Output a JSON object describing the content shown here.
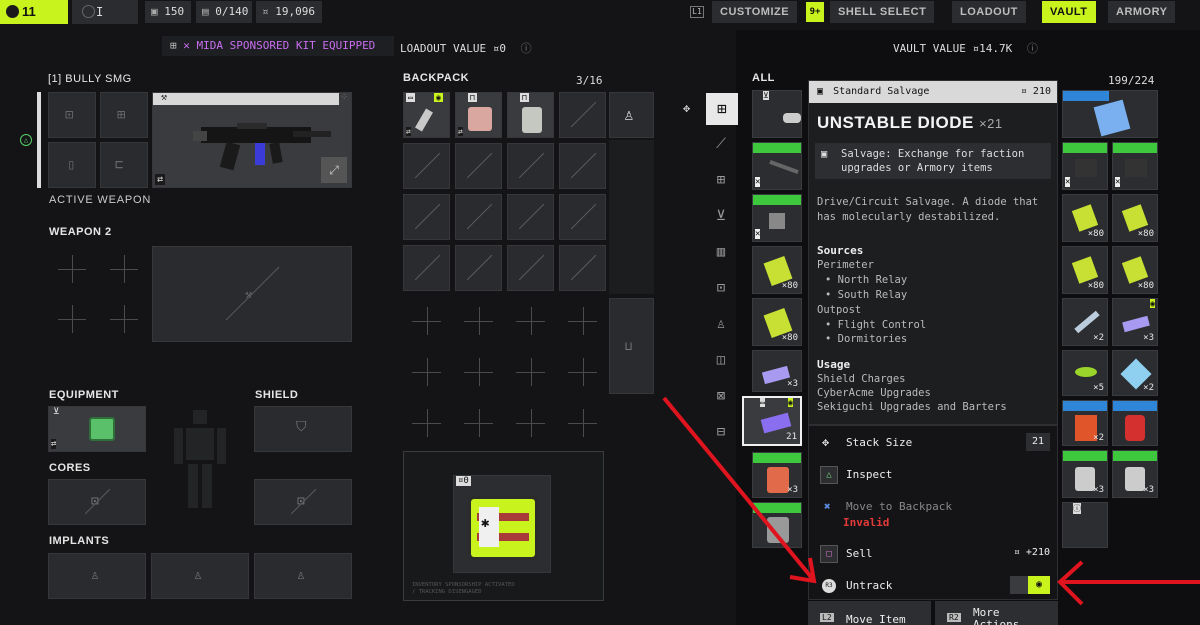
{
  "top_bar": {
    "level": "11",
    "rank_glyph": "I",
    "stat_1": "150",
    "stat_2": "0/140",
    "credits": "19,096",
    "l1_hint": "L1",
    "tabs": {
      "customize": "CUSTOMIZE",
      "badge": "9+",
      "shell_select": "SHELL SELECT",
      "loadout": "LOADOUT",
      "vault": "VAULT",
      "armory": "ARMORY"
    }
  },
  "loadout_header": {
    "sponsored": "MIDA SPONSORED KIT EQUIPPED",
    "value_label": "LOADOUT VALUE",
    "value": "¤0",
    "info_icon": "info-icon"
  },
  "vault_header": {
    "value_label": "VAULT VALUE",
    "value": "¤14.7K"
  },
  "weapon1": {
    "slot_label": "[1] BULLY SMG",
    "caption": "ACTIVE WEAPON"
  },
  "weapon2": {
    "label": "WEAPON 2"
  },
  "equipment": {
    "label": "EQUIPMENT"
  },
  "shield": {
    "label": "SHIELD"
  },
  "cores": {
    "label": "CORES"
  },
  "implants": {
    "label": "IMPLANTS"
  },
  "backpack": {
    "label": "BACKPACK",
    "count": "3/16",
    "kit_value": "¤0",
    "kit_caption_1": "INVENTORY SPONSORSHIP ACTIVATED",
    "kit_caption_2": "/ TRACKING DISENGAGED"
  },
  "vault": {
    "filter": "ALL",
    "count": "199/224"
  },
  "tooltip": {
    "category": "Standard Salvage",
    "price": "¤ 210",
    "name": "UNSTABLE DIODE",
    "qty": "×21",
    "salvage_note": "Salvage: Exchange for faction upgrades or Armory items",
    "description": "Drive/Circuit Salvage. A diode that has molecularly destabilized.",
    "sources_title": "Sources",
    "source_1": "Perimeter",
    "source_1a": "• North Relay",
    "source_1b": "• South Relay",
    "source_2": "Outpost",
    "source_2a": "• Flight Control",
    "source_2b": "• Dormitories",
    "usage_title": "Usage",
    "usage_1": "Shield Charges",
    "usage_2": "CyberAcme Upgrades",
    "usage_3": "Sekiguchi Upgrades and Barters"
  },
  "actions": {
    "stack_size": "Stack Size",
    "stack_value": "21",
    "inspect": "Inspect",
    "move_backpack": "Move to Backpack",
    "invalid": "Invalid",
    "sell": "Sell",
    "sell_value": "¤ +210",
    "untrack": "Untrack",
    "move_item": "Move Item",
    "more_actions": "More Actions",
    "l2": "L2",
    "r2": "R2",
    "r3": "R3"
  },
  "vault_quantities": {
    "q1": "×80",
    "q2": "×80",
    "q3": "×80",
    "q4": "×80",
    "q5": "×80",
    "q6": "×80",
    "q7": "×2",
    "q8": "×3",
    "q9": "×3",
    "q10": "×5",
    "q11": "×2",
    "q12": "21",
    "q13": "×2",
    "q14": "×3",
    "q15": "×3",
    "q16": "×3"
  },
  "colors": {
    "accent": "#c8f31d",
    "arrow": "#e0141e",
    "invalid": "#e23a3a",
    "sponsor": "#c96ef0"
  }
}
